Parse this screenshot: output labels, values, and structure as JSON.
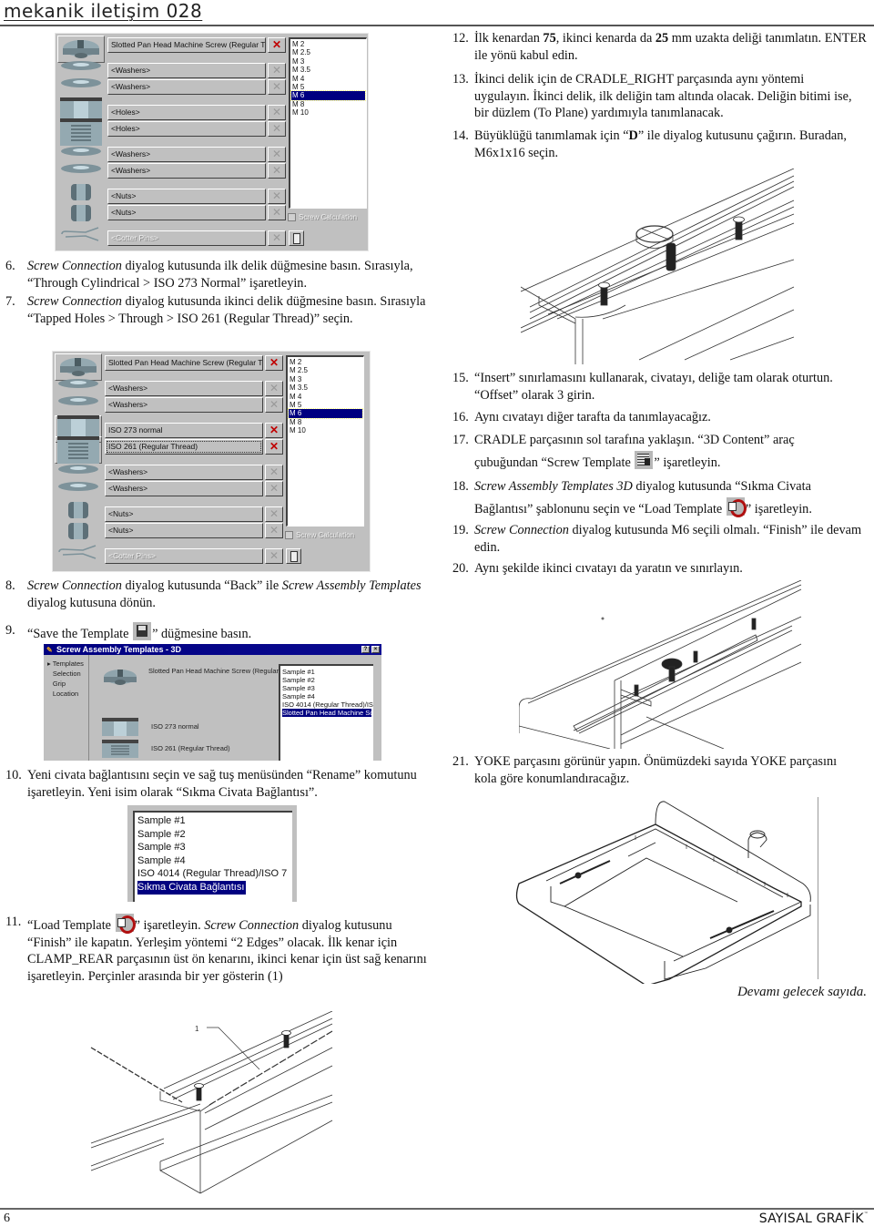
{
  "header": {
    "title": "mekanik iletişim 028"
  },
  "footer": {
    "page_number": "6",
    "brand": "SAYISAL GRAFİK",
    "trademark": "™"
  },
  "screw_dialog_1": {
    "rows": [
      {
        "label": "Slotted Pan Head Machine Screw (Regular Thread)",
        "icon": "screw-head-icon",
        "active": true,
        "disabled": false
      },
      {
        "label": "<Washers>",
        "icon": "washer-icon",
        "active": false,
        "disabled": false
      },
      {
        "label": "<Washers>",
        "icon": "washer-icon",
        "active": false,
        "disabled": false
      },
      {
        "label": "<Holes>",
        "icon": "cylindrical-hole-icon",
        "active": false,
        "disabled": false
      },
      {
        "label": "<Holes>",
        "icon": "tapped-hole-icon",
        "active": false,
        "disabled": false
      },
      {
        "label": "<Washers>",
        "icon": "washer-icon",
        "active": false,
        "disabled": false
      },
      {
        "label": "<Washers>",
        "icon": "washer-icon",
        "active": false,
        "disabled": false
      },
      {
        "label": "<Nuts>",
        "icon": "nut-icon",
        "active": false,
        "disabled": false
      },
      {
        "label": "<Nuts>",
        "icon": "nut-icon",
        "active": false,
        "disabled": false
      },
      {
        "label": "<Cotter Pins>",
        "icon": "cotter-pin-icon",
        "active": false,
        "disabled": true
      }
    ],
    "sizes": [
      "M 2",
      "M 2.5",
      "M 3",
      "M 3.5",
      "M 4",
      "M 5",
      "M 6",
      "M 8",
      "M 10"
    ],
    "selected_size": "M 6",
    "screw_calculation_label": "Screw Calculation",
    "screw_calculation_checked": false
  },
  "screw_dialog_2": {
    "rows": [
      {
        "label": "Slotted Pan Head Machine Screw (Regular Thread)",
        "icon": "screw-head-icon",
        "active": true,
        "disabled": false
      },
      {
        "label": "<Washers>",
        "icon": "washer-icon",
        "active": false,
        "disabled": false
      },
      {
        "label": "<Washers>",
        "icon": "washer-icon",
        "active": false,
        "disabled": false
      },
      {
        "label": "ISO 273 normal",
        "icon": "cylindrical-hole-icon",
        "active": true,
        "disabled": false
      },
      {
        "label": "ISO 261  (Regular Thread)",
        "icon": "tapped-hole-icon",
        "active": true,
        "disabled": false,
        "focused": true
      },
      {
        "label": "<Washers>",
        "icon": "washer-icon",
        "active": false,
        "disabled": false
      },
      {
        "label": "<Washers>",
        "icon": "washer-icon",
        "active": false,
        "disabled": false
      },
      {
        "label": "<Nuts>",
        "icon": "nut-icon",
        "active": false,
        "disabled": false
      },
      {
        "label": "<Nuts>",
        "icon": "nut-icon",
        "active": false,
        "disabled": false
      },
      {
        "label": "<Cotter Pins>",
        "icon": "cotter-pin-icon",
        "active": false,
        "disabled": true
      }
    ],
    "sizes": [
      "M 2",
      "M 2.5",
      "M 3",
      "M 3.5",
      "M 4",
      "M 5",
      "M 6",
      "M 8",
      "M 10"
    ],
    "selected_size": "M 6",
    "screw_calculation_label": "Screw Calculation",
    "screw_calculation_checked": false
  },
  "templates_dialog": {
    "title": "Screw Assembly Templates - 3D",
    "help_button": "?",
    "close_button": "×",
    "nav": [
      "Templates",
      "Selection",
      "Grip",
      "Location"
    ],
    "current_nav": "Templates",
    "components": [
      {
        "label": "Slotted Pan Head Machine Screw (Regular",
        "icon": "screw-head-icon"
      },
      {
        "label": "ISO 273 normal",
        "icon": "cylindrical-hole-icon"
      },
      {
        "label": "ISO 261  (Regular Thread)",
        "icon": "tapped-hole-icon"
      }
    ],
    "templates": [
      "Sample #1",
      "Sample #2",
      "Sample #3",
      "Sample #4",
      "ISO 4014  (Regular Thread)/ISO 7",
      "Slotted Pan Head Machine Screw"
    ],
    "selected_template": "Slotted Pan Head Machine Screw"
  },
  "renamed_list": {
    "items": [
      "Sample #1",
      "Sample #2",
      "Sample #3",
      "Sample #4",
      "ISO 4014  (Regular Thread)/ISO 7",
      "Sıkma Civata Bağlantısı"
    ],
    "selected": "Sıkma Civata Bağlantısı"
  },
  "steps": {
    "s6": {
      "num": "6.",
      "a_it": "Screw Connection",
      "b": " diyalog kutusunda ilk delik düğmesine basın. Sırasıyla, “Through Cylindrical > ISO 273 Normal” işaretleyin."
    },
    "s7": {
      "num": "7.",
      "a_it": "Screw Connection",
      "b": " diyalog kutusunda ikinci delik düğmesine basın. Sırasıyla “Tapped Holes > Through > ISO 261 (Regular Thread)” seçin."
    },
    "s8": {
      "num": "8.",
      "a_it": "Screw Connection",
      "b": " diyalog kutusunda “Back” ile ",
      "c_it": "Screw Assembly Templates",
      "d": " diyalog kutusuna dönün."
    },
    "s9": {
      "num": "9.",
      "a": "“Save the Template ",
      "b": "” düğmesine basın."
    },
    "s10": {
      "num": "10.",
      "text": "Yeni civata bağlantısını seçin ve sağ tuş menüsünden “Rename” komutunu işaretleyin. Yeni isim olarak “Sıkma Civata Bağlantısı”."
    },
    "s11": {
      "num": "11.",
      "a": "“Load Template ",
      "b": "” işaretleyin. ",
      "c_it": "Screw Connection",
      "d": " diyalog kutusunu “Finish” ile kapatın. Yerleşim yöntemi “2 Edges” olacak. İlk kenar için CLAMP_REAR parçasının üst ön kenarını, ikinci kenar için üst sağ kenarını işaretleyin. Perçinler arasında bir yer gösterin (1)"
    },
    "s12": {
      "num": "12.",
      "a": "İlk kenardan ",
      "b_bold": "75",
      "c": ", ikinci kenarda da ",
      "d_bold": "25",
      "e": " mm uzakta deliği tanımlatın. ENTER ile yönü kabul edin."
    },
    "s13": {
      "num": "13.",
      "text": "İkinci delik için de CRADLE_RIGHT parçasında aynı yöntemi uygulayın. İkinci delik, ilk deliğin tam altında olacak. Deliğin bitimi ise, bir düzlem (To Plane) yardımıyla tanımlanacak."
    },
    "s14": {
      "num": "14.",
      "a": "Büyüklüğü tanımlamak için “",
      "b_bold": "D",
      "c": "” ile diyalog kutusunu çağırın. Buradan, M6x1x16 seçin."
    },
    "s15": {
      "num": "15.",
      "text": "“Insert” sınırlamasını kullanarak, civatayı, deliğe tam olarak oturtun. “Offset” olarak 3 girin."
    },
    "s16": {
      "num": "16.",
      "text": "Aynı cıvatayı diğer tarafta da tanımlayacağız."
    },
    "s17": {
      "num": "17.",
      "a": "CRADLE parçasının sol tarafına yaklaşın. “3D Content” araç çubuğundan “Screw Template ",
      "b": "” işaretleyin."
    },
    "s18": {
      "num": "18.",
      "a_it": "Screw Assembly Templates 3D",
      "b": " diyalog kutusunda “Sıkma Civata Bağlantısı” şablonunu seçin ve “Load Template ",
      "c": "” işaretleyin."
    },
    "s19": {
      "num": "19.",
      "a_it": "Screw Connection",
      "b": " diyalog kutusunda M6 seçili olmalı. “Finish” ile devam edin."
    },
    "s20": {
      "num": "20.",
      "text": "Aynı şekilde ikinci cıvatayı da yaratın ve sınırlayın."
    },
    "s21": {
      "num": "21.",
      "text": "YOKE parçasını görünür yapın. Önümüzdeki sayıda YOKE parçasını kola göre konumlandıracağız."
    }
  },
  "drawing_labels": {
    "callout_1": "1"
  },
  "continued_note": "Devamı gelecek sayıda."
}
